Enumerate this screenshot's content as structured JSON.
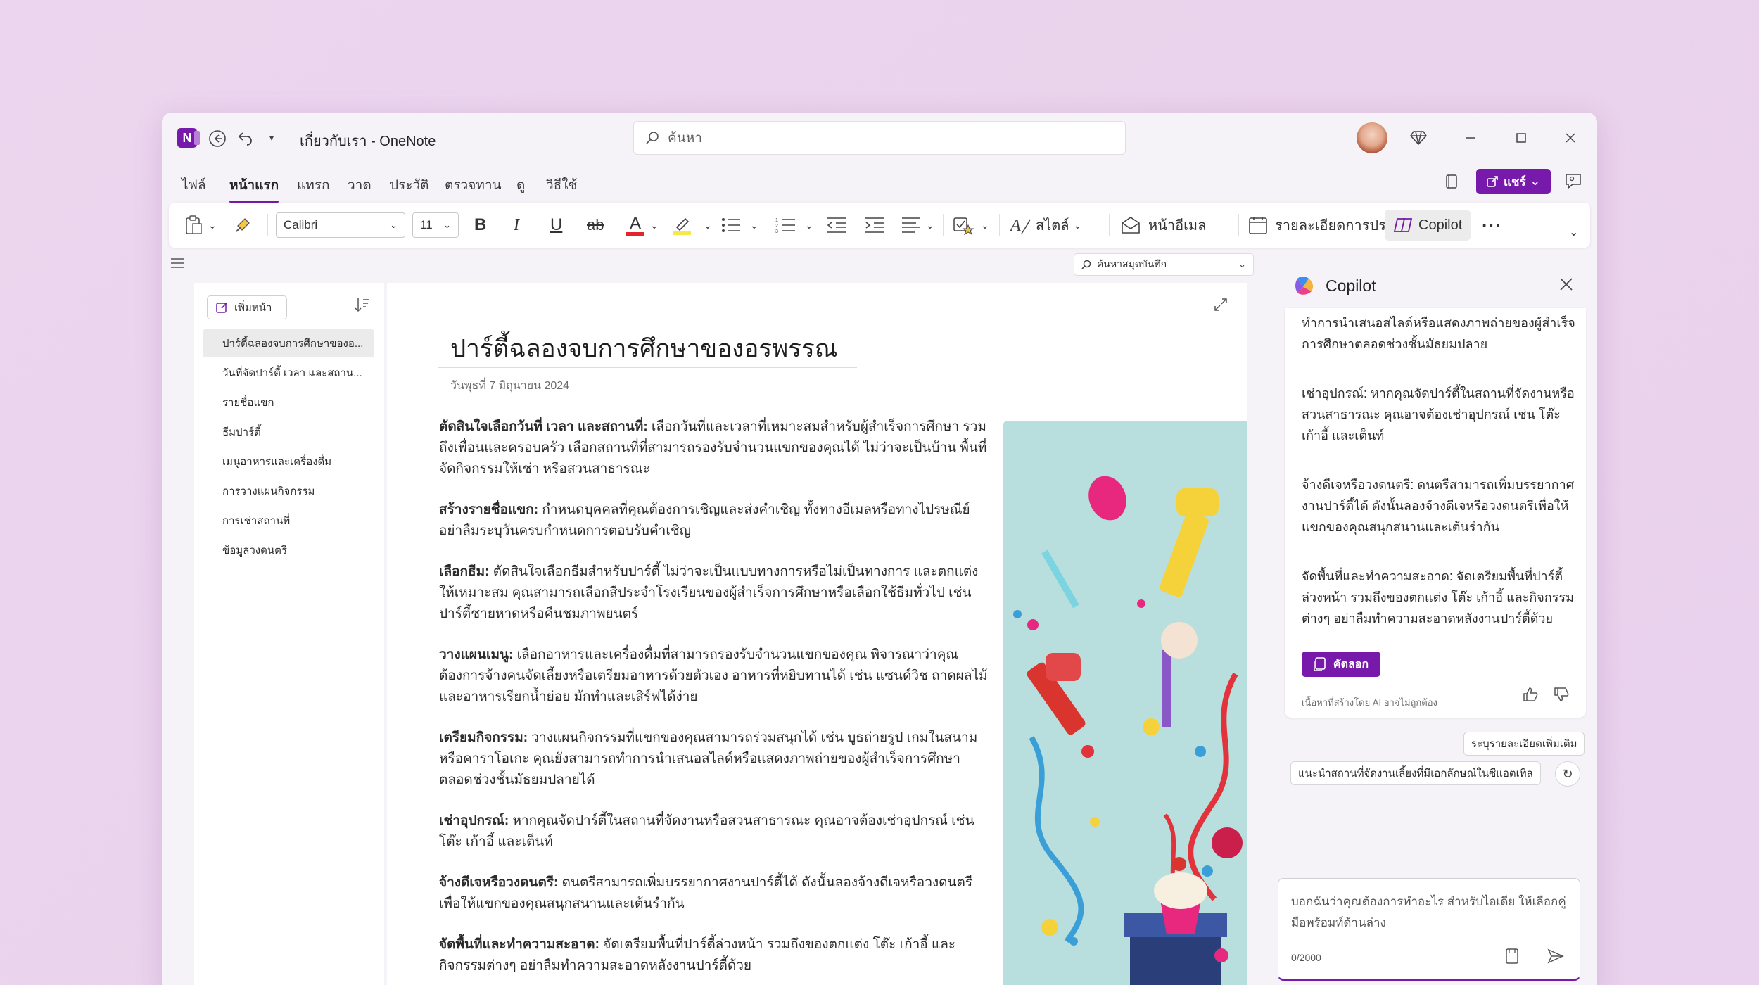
{
  "app": {
    "title": "เกี่ยวกับเรา - OneNote",
    "logo_letter": "N",
    "search_placeholder": "ค้นหา"
  },
  "menu": {
    "tabs": [
      "ไฟล์",
      "หน้าแรก",
      "แทรก",
      "วาด",
      "ประวัติ",
      "ตรวจทาน",
      "ดู",
      "วิธีใช้"
    ],
    "active_tab": "หน้าแรก",
    "share_label": "แชร์"
  },
  "ribbon": {
    "font_name": "Calibri",
    "font_size": "11",
    "bold": "B",
    "italic": "I",
    "underline": "U",
    "strike": "ab",
    "font_color": "A",
    "styles_label": "สไตล์",
    "email_label": "หน้าอีเมล",
    "meeting_label": "รายละเอียดการประชุม",
    "copilot_label": "Copilot",
    "more": "···",
    "accent_color": "#7719aa",
    "font_color_bar": "#e3242b",
    "highlight_bar": "#f6e84a"
  },
  "notebook_search": {
    "placeholder": "ค้นหาสมุดบันทึก"
  },
  "pages": {
    "add_page_label": "เพิ่มหน้า",
    "items": [
      "ปาร์ตี้ฉลองจบการศึกษาของอ...",
      "วันที่จัดปาร์ตี้ เวลา และสถาน...",
      "รายชื่อแขก",
      "ธีมปาร์ตี้",
      "เมนูอาหารและเครื่องดื่ม",
      "การวางแผนกิจกรรม",
      "การเช่าสถานที่",
      "ข้อมูลวงดนตรี"
    ],
    "selected_index": 0
  },
  "note": {
    "title": "ปาร์ตี้ฉลองจบการศึกษาของอรพรรณ",
    "date": "วันพุธที่ 7 มิถุนายน 2024",
    "paragraphs": [
      {
        "label": "ตัดสินใจเลือกวันที่ เวลา และสถานที่:",
        "text": " เลือกวันที่และเวลาที่เหมาะสมสำหรับผู้สำเร็จการศึกษา รวมถึงเพื่อนและครอบครัว เลือกสถานที่ที่สามารถรองรับจำนวนแขกของคุณได้ ไม่ว่าจะเป็นบ้าน พื้นที่จัดกิจกรรมให้เช่า หรือสวนสาธารณะ"
      },
      {
        "label": "สร้างรายชื่อแขก:",
        "text": " กำหนดบุคคลที่คุณต้องการเชิญและส่งคำเชิญ ทั้งทางอีเมลหรือทางไปรษณีย์ อย่าลืมระบุวันครบกำหนดการตอบรับคำเชิญ"
      },
      {
        "label": "เลือกธีม:",
        "text": " ตัดสินใจเลือกธีมสำหรับปาร์ตี้ ไม่ว่าจะเป็นแบบทางการหรือไม่เป็นทางการ และตกแต่งให้เหมาะสม คุณสามารถเลือกสีประจำโรงเรียนของผู้สำเร็จการศึกษาหรือเลือกใช้ธีมทั่วไป เช่น ปาร์ตี้ชายหาดหรือคืนชมภาพยนตร์"
      },
      {
        "label": "วางแผนเมนู:",
        "text": " เลือกอาหารและเครื่องดื่มที่สามารถรองรับจำนวนแขกของคุณ พิจารณาว่าคุณต้องการจ้างคนจัดเลี้ยงหรือเตรียมอาหารด้วยตัวเอง อาหารที่หยิบทานได้ เช่น แซนด์วิช ถาดผลไม้ และอาหารเรียกน้ำย่อย มักทำและเสิร์ฟได้ง่าย"
      },
      {
        "label": "เตรียมกิจกรรม:",
        "text": " วางแผนกิจกรรมที่แขกของคุณสามารถร่วมสนุกได้ เช่น บูธถ่ายรูป เกมในสนาม หรือคาราโอเกะ คุณยังสามารถทำการนำเสนอสไลด์หรือแสดงภาพถ่ายของผู้สำเร็จการศึกษาตลอดช่วงชั้นมัธยมปลายได้"
      },
      {
        "label": "เช่าอุปกรณ์:",
        "text": " หากคุณจัดปาร์ตี้ในสถานที่จัดงานหรือสวนสาธารณะ คุณอาจต้องเช่าอุปกรณ์ เช่น โต๊ะ เก้าอี้ และเต็นท์"
      },
      {
        "label": "จ้างดีเจหรือวงดนตรี:",
        "text": " ดนตรีสามารถเพิ่มบรรยากาศงานปาร์ตี้ได้ ดังนั้นลองจ้างดีเจหรือวงดนตรีเพื่อให้แขกของคุณสนุกสนานและเต้นรำกัน"
      },
      {
        "label": "จัดพื้นที่และทำความสะอาด:",
        "text": " จัดเตรียมพื้นที่ปาร์ตี้ล่วงหน้า รวมถึงของตกแต่ง โต๊ะ เก้าอี้ และกิจกรรมต่างๆ อย่าลืมทำความสะอาดหลังงานปาร์ตี้ด้วย"
      }
    ]
  },
  "copilot": {
    "title": "Copilot",
    "messages": [
      "ทำการนำเสนอสไลด์หรือแสดงภาพถ่ายของผู้สำเร็จการศึกษาตลอดช่วงชั้นมัธยมปลาย",
      "เช่าอุปกรณ์: หากคุณจัดปาร์ตี้ในสถานที่จัดงานหรือสวนสาธารณะ คุณอาจต้องเช่าอุปกรณ์ เช่น โต๊ะ เก้าอี้ และเต็นท์",
      "จ้างดีเจหรือวงดนตรี: ดนตรีสามารถเพิ่มบรรยากาศงานปาร์ตี้ได้ ดังนั้นลองจ้างดีเจหรือวงดนตรีเพื่อให้แขกของคุณสนุกสนานและเต้นรำกัน",
      "จัดพื้นที่และทำความสะอาด: จัดเตรียมพื้นที่ปาร์ตี้ล่วงหน้า รวมถึงของตกแต่ง โต๊ะ เก้าอี้ และกิจกรรมต่างๆ อย่าลืมทำความสะอาดหลังงานปาร์ตี้ด้วย"
    ],
    "copy_label": "คัดลอก",
    "ai_disclaimer": "เนื้อหาที่สร้างโดย AI อาจไม่ถูกต้อง",
    "suggestions": [
      "ระบุรายละเอียดเพิ่มเติม",
      "แนะนำสถานที่จัดงานเลี้ยงที่มีเอกลักษณ์ในซีแอตเทิล"
    ],
    "input_placeholder": "บอกฉันว่าคุณต้องการทำอะไร สำหรับไอเดีย ให้เลือกคู่มือพร้อมท์ด้านล่าง",
    "char_counter": "0/2000"
  }
}
